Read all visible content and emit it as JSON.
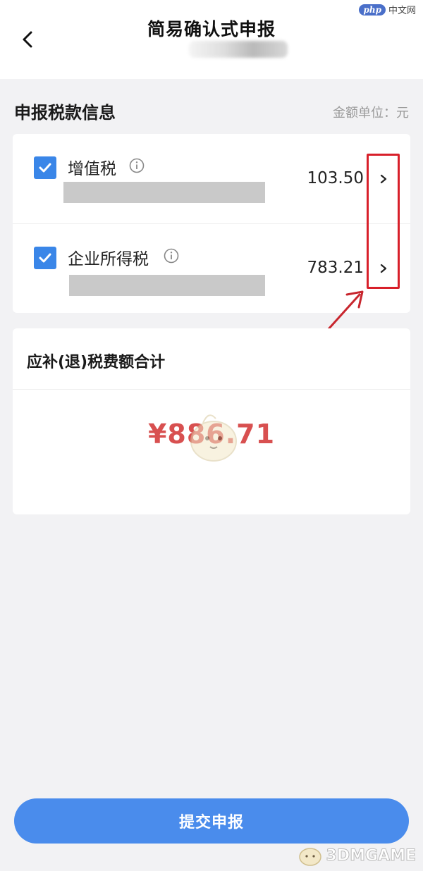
{
  "header": {
    "title": "简易确认式申报"
  },
  "site_logo": {
    "badge": "php",
    "text": "中文网"
  },
  "section": {
    "title": "申报税款信息",
    "unit_note": "金额单位：元"
  },
  "tax_items": [
    {
      "name": "增值税",
      "amount": "103.50",
      "checked": true
    },
    {
      "name": "企业所得税",
      "amount": "783.21",
      "checked": true
    }
  ],
  "total": {
    "title": "应补(退)税费额合计",
    "amount": "¥886.71"
  },
  "submit": {
    "label": "提交申报"
  },
  "footer_mark": {
    "text": "3DMGAME"
  },
  "colors": {
    "accent": "#3a86e8",
    "submit": "#4a8cec",
    "total_amount": "#d85050",
    "highlight": "#d8202a"
  }
}
